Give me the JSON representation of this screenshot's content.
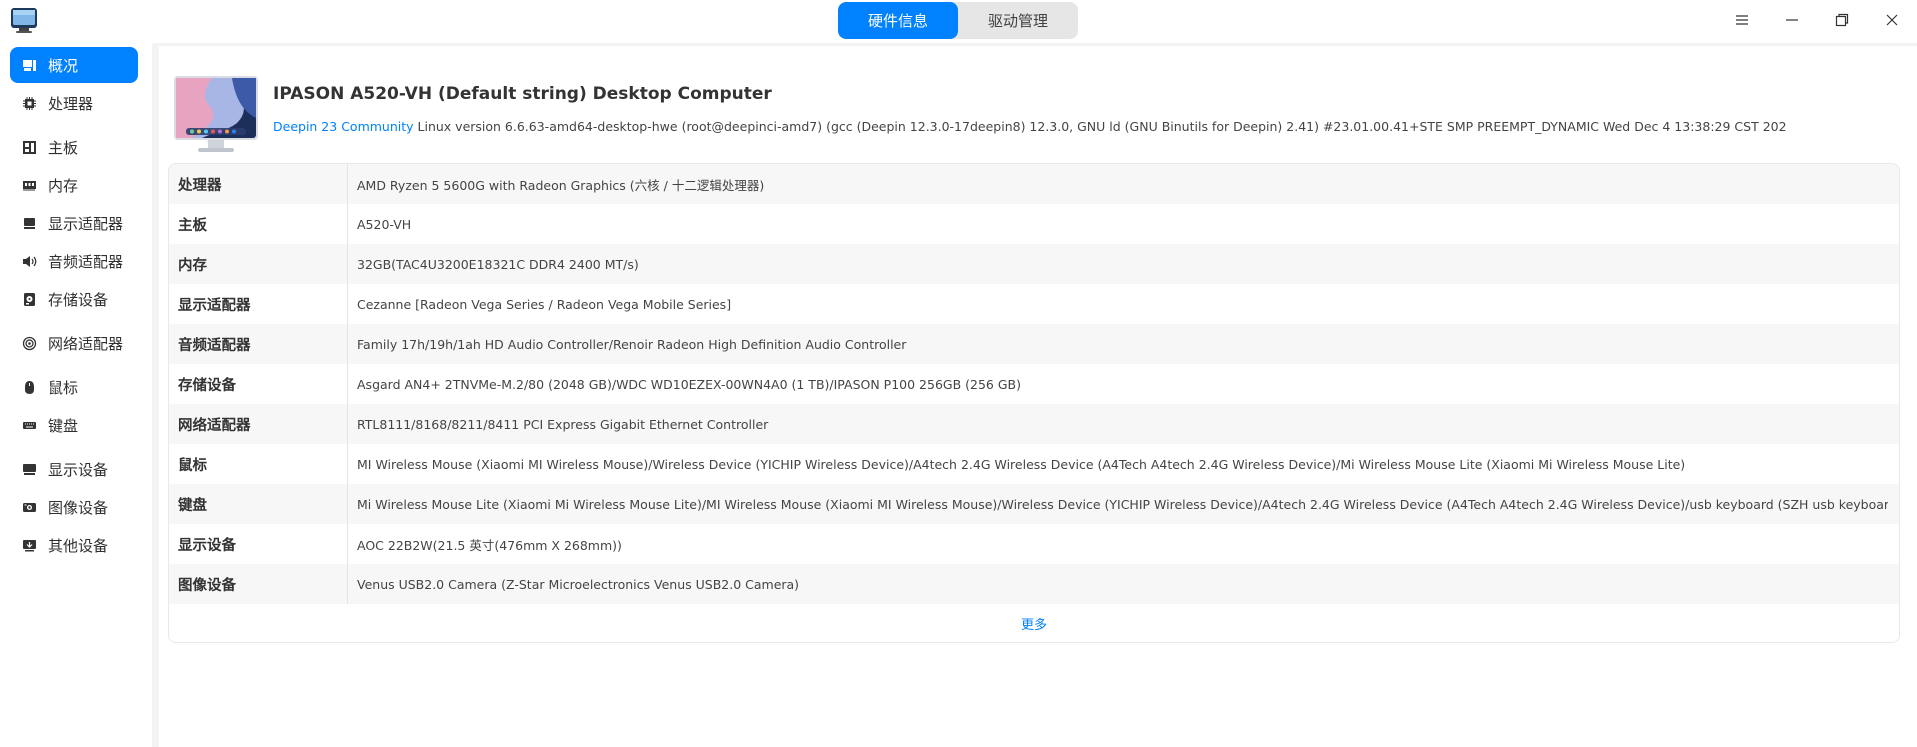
{
  "header": {
    "tabs": [
      {
        "label": "硬件信息",
        "active": true
      },
      {
        "label": "驱动管理",
        "active": false
      }
    ]
  },
  "sidebar": {
    "items": [
      {
        "label": "概况",
        "icon": "overview-icon",
        "active": true
      },
      {
        "label": "处理器",
        "icon": "cpu-icon"
      },
      {
        "label": "主板",
        "icon": "motherboard-icon"
      },
      {
        "label": "内存",
        "icon": "memory-icon"
      },
      {
        "label": "显示适配器",
        "icon": "display-adapter-icon"
      },
      {
        "label": "音频适配器",
        "icon": "audio-adapter-icon"
      },
      {
        "label": "存储设备",
        "icon": "storage-icon"
      },
      {
        "label": "网络适配器",
        "icon": "network-icon"
      },
      {
        "label": "鼠标",
        "icon": "mouse-icon"
      },
      {
        "label": "键盘",
        "icon": "keyboard-icon"
      },
      {
        "label": "显示设备",
        "icon": "monitor-icon"
      },
      {
        "label": "图像设备",
        "icon": "camera-icon"
      },
      {
        "label": "其他设备",
        "icon": "other-devices-icon"
      }
    ]
  },
  "overview": {
    "title": "IPASON A520-VH (Default string) Desktop Computer",
    "os_link": "Deepin 23 Community",
    "os_detail": " Linux version 6.6.63-amd64-desktop-hwe (root@deepinci-amd7) (gcc (Deepin 12.3.0-17deepin8) 12.3.0, GNU ld (GNU Binutils for Deepin) 2.41) #23.01.00.41+STE SMP PREEMPT_DYNAMIC Wed Dec 4 13:38:29 CST 202",
    "rows": [
      {
        "key": "处理器",
        "value": "AMD Ryzen 5 5600G with Radeon Graphics (六核 / 十二逻辑处理器)"
      },
      {
        "key": "主板",
        "value": "A520-VH"
      },
      {
        "key": "内存",
        "value": "32GB(TAC4U3200E18321C DDR4 2400 MT/s)"
      },
      {
        "key": "显示适配器",
        "value": "Cezanne [Radeon Vega Series / Radeon Vega Mobile Series]"
      },
      {
        "key": "音频适配器",
        "value": "Family 17h/19h/1ah HD Audio Controller/Renoir Radeon High Definition Audio Controller"
      },
      {
        "key": "存储设备",
        "value": "Asgard AN4+ 2TNVMe-M.2/80 (2048 GB)/WDC WD10EZEX-00WN4A0 (1 TB)/IPASON P100 256GB (256 GB)"
      },
      {
        "key": "网络适配器",
        "value": "RTL8111/8168/8211/8411 PCI Express Gigabit Ethernet Controller"
      },
      {
        "key": "鼠标",
        "value": "MI Wireless Mouse (Xiaomi MI Wireless Mouse)/Wireless Device (YICHIP Wireless Device)/A4tech 2.4G Wireless Device (A4Tech A4tech 2.4G Wireless Device)/Mi Wireless Mouse Lite (Xiaomi Mi Wireless Mouse Lite)"
      },
      {
        "key": "键盘",
        "value": "Mi Wireless Mouse Lite (Xiaomi Mi Wireless Mouse Lite)/MI Wireless Mouse (Xiaomi MI Wireless Mouse)/Wireless Device (YICHIP Wireless Device)/A4tech 2.4G Wireless Device (A4Tech A4tech 2.4G Wireless Device)/usb keyboard (SZH usb keyboard)"
      },
      {
        "key": "显示设备",
        "value": "AOC 22B2W(21.5 英寸(476mm X 268mm))"
      },
      {
        "key": "图像设备",
        "value": "Venus USB2.0 Camera (Z-Star Microelectronics Venus USB2.0 Camera)"
      }
    ],
    "more_label": "更多"
  },
  "colors": {
    "accent": "#0081ff",
    "sidebar_bg": "#ffffff",
    "window_bg": "#f3f3f3"
  }
}
